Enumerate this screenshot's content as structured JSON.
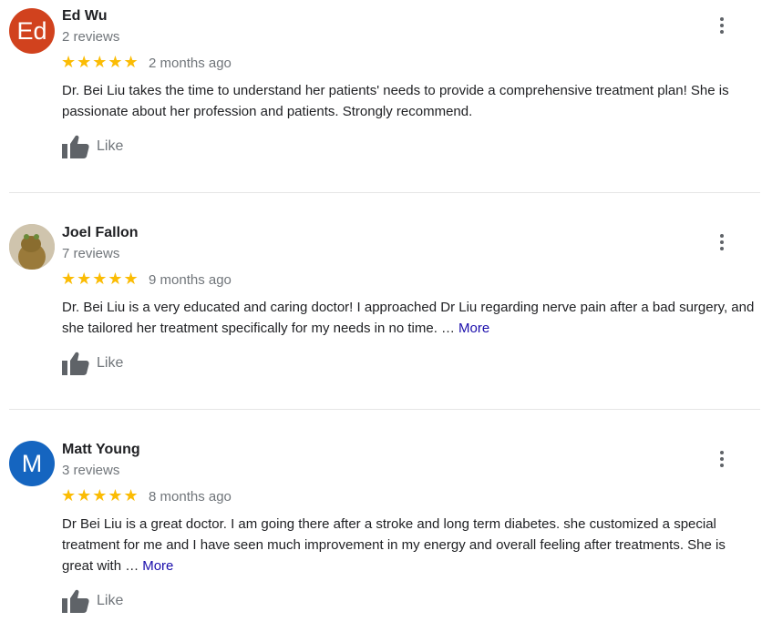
{
  "reviews": [
    {
      "avatar_letter": "Ed",
      "name": "Ed Wu",
      "review_count": "2 reviews",
      "stars": "★★★★★",
      "date": "2 months ago",
      "text": "Dr. Bei Liu takes the time to understand her patients' needs to provide a comprehensive treatment plan! She is passionate about her profession and patients. Strongly recommend.",
      "more": "",
      "like_label": "Like"
    },
    {
      "avatar_letter": "",
      "name": "Joel Fallon",
      "review_count": "7 reviews",
      "stars": "★★★★★",
      "date": "9 months ago",
      "text": "Dr. Bei Liu is a very educated and caring doctor! I approached Dr Liu regarding nerve pain after a bad surgery, and she tailored her treatment specifically for my needs in no time. …",
      "more": "More",
      "like_label": "Like"
    },
    {
      "avatar_letter": "M",
      "name": "Matt Young",
      "review_count": "3 reviews",
      "stars": "★★★★★",
      "date": "8 months ago",
      "text": "Dr Bei Liu is a great doctor. I am going there after a stroke and long term diabetes. she customized a special treatment for me and I have seen much improvement in my energy and overall feeling after treatments. She is great with …",
      "more": "More",
      "like_label": "Like"
    }
  ],
  "colors": {
    "star": "#fbbc04",
    "link": "#1a0dab",
    "avatar_ed": "#d1421e",
    "avatar_matt": "#1565c0"
  },
  "icons": {
    "menu": "more-vert-icon",
    "like": "thumb-up-icon"
  }
}
